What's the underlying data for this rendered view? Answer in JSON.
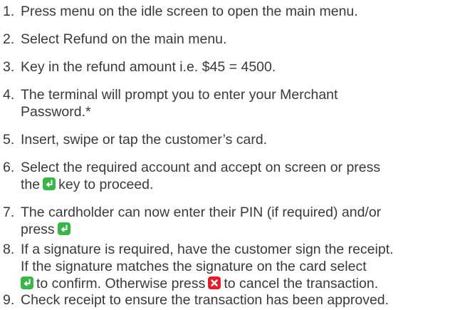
{
  "colors": {
    "text": "#3a3a3c",
    "enter_key": "#39b54a",
    "cancel_key": "#e2202c"
  },
  "icons": {
    "enter": "enter-key-icon",
    "cancel": "cancel-key-icon"
  },
  "steps": [
    {
      "num": "1.",
      "text": "Press menu on the idle screen to open the main menu."
    },
    {
      "num": "2.",
      "text": "Select Refund on the main menu."
    },
    {
      "num": "3.",
      "text": "Key in the refund amount i.e. $45 = 4500."
    },
    {
      "num": "4.",
      "line1": "The terminal will prompt you to enter your Merchant",
      "line2": "Password.*"
    },
    {
      "num": "5.",
      "text": "Insert, swipe or tap the customer’s card."
    },
    {
      "num": "6.",
      "line1": "Select the required account and accept on screen or press",
      "line2_pre": "the",
      "line2_post": "key to proceed."
    },
    {
      "num": "7.",
      "line1": "The cardholder can now enter their PIN (if required) and/or",
      "line2_pre": "press"
    },
    {
      "num": "8.",
      "line1": "If a signature is required, have the customer sign the receipt.",
      "line2": "If the signature matches the signature on the card select",
      "line3_mid": "to confirm. Otherwise press",
      "line3_post": "to cancel the transaction."
    },
    {
      "num": "9.",
      "text": "Check receipt to ensure the transaction has been approved."
    }
  ]
}
